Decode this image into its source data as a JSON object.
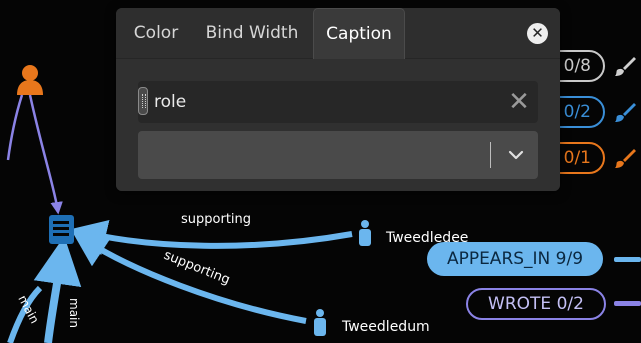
{
  "graph": {
    "nodes": {
      "tweedledee": "Tweedledee",
      "tweedledum": "Tweedledum"
    },
    "edges": {
      "supporting_1": "supporting",
      "supporting_2": "supporting",
      "main_1": "main",
      "main_2": "main"
    }
  },
  "legend": {
    "character": "Character 0/8",
    "book": "Book 0/2",
    "author": "Author 0/1",
    "appears_in": "APPEARS_IN 9/9",
    "wrote": "WROTE 0/2"
  },
  "popup": {
    "tabs": [
      "Color",
      "Bind Width",
      "Caption"
    ],
    "active_tab": "Caption",
    "close_glyph": "✕",
    "caption_field": {
      "value": "role",
      "clear_glyph": "✕"
    },
    "select": {
      "value": ""
    }
  },
  "colors": {
    "background": "#050505",
    "character": "#c9c9c9",
    "book": "#3a8fd8",
    "author": "#e8771c",
    "appears_in": "#6bb6ee",
    "wrote": "#8b83e6",
    "popup_bg": "#262626"
  },
  "icons": [
    "person-icon",
    "book-icon",
    "brush-icon",
    "close-icon",
    "chevron-down-icon",
    "drag-handle-icon"
  ]
}
